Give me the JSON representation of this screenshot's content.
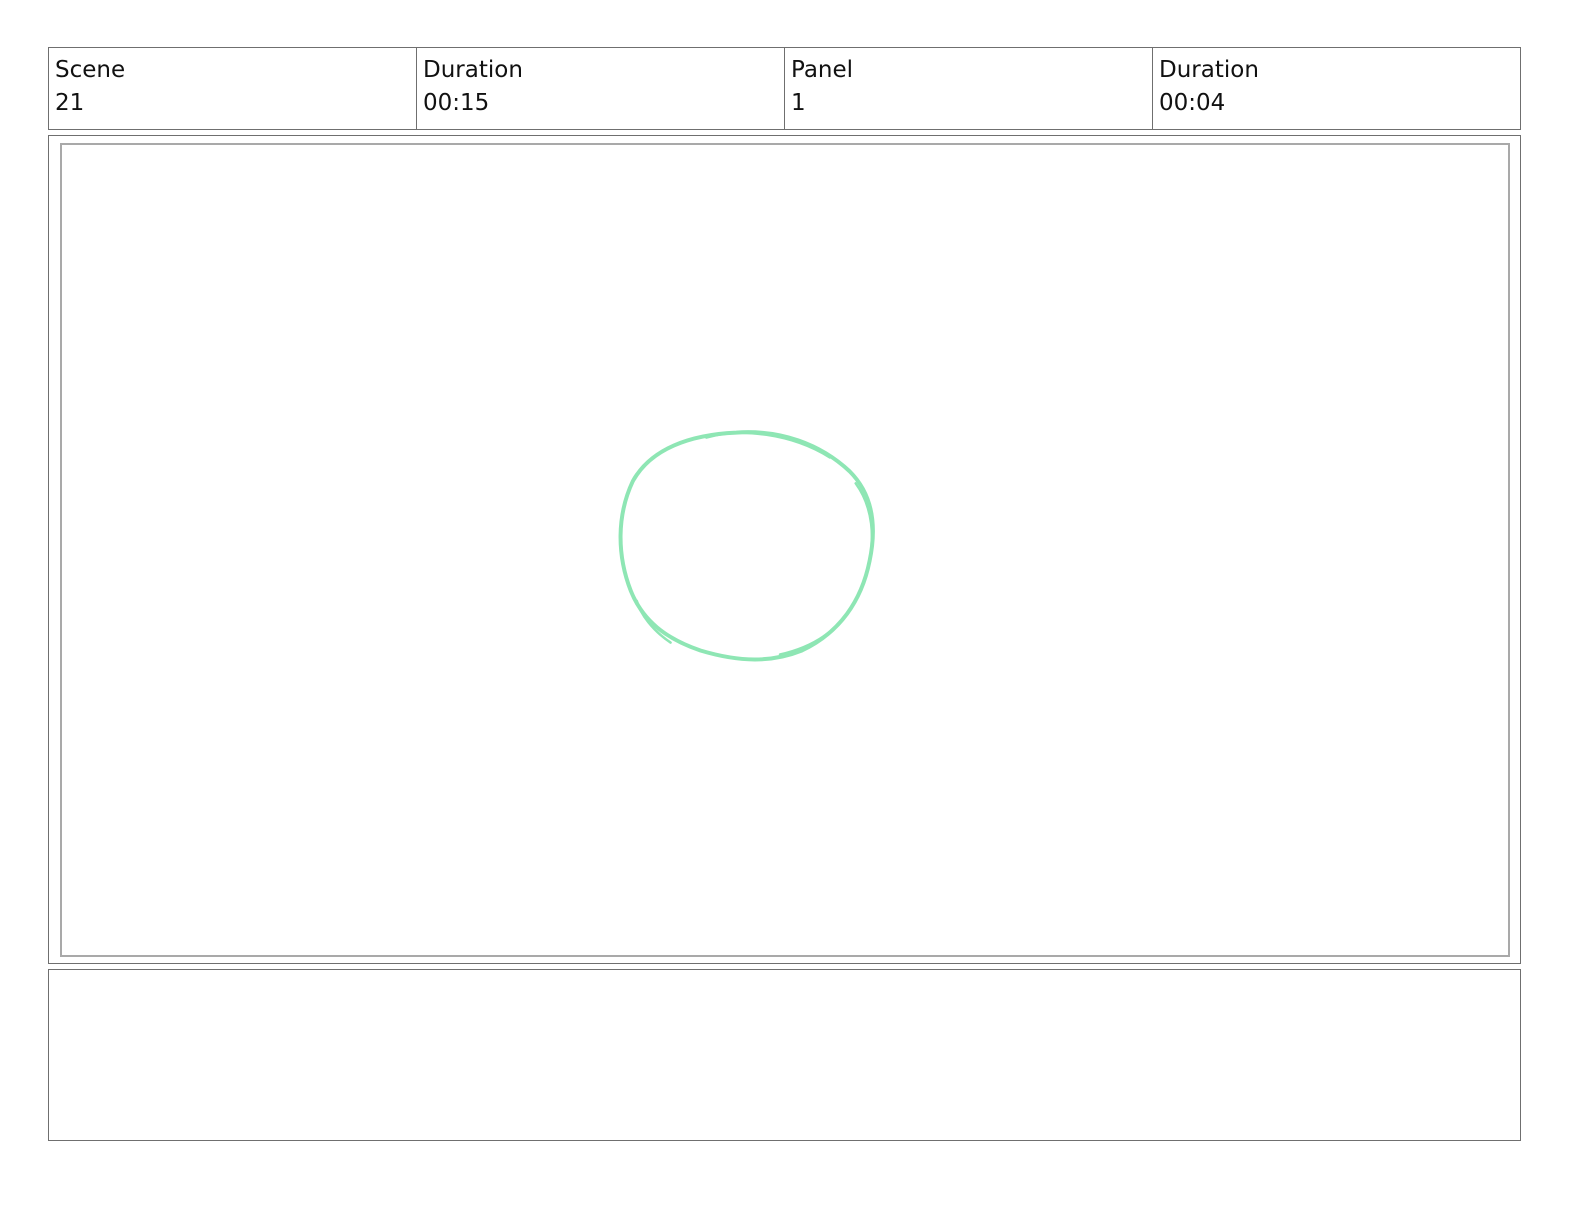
{
  "header": {
    "cells": [
      {
        "label": "Scene",
        "value": "21"
      },
      {
        "label": "Duration",
        "value": "00:15"
      },
      {
        "label": "Panel",
        "value": "1"
      },
      {
        "label": "Duration",
        "value": "00:04"
      }
    ]
  },
  "panel": {
    "sketch_stroke_color": "#8ee6b4",
    "frame_border_color": "#6f6f6f",
    "inner_border_color": "#a9a9a9"
  },
  "notes": {
    "text": ""
  }
}
